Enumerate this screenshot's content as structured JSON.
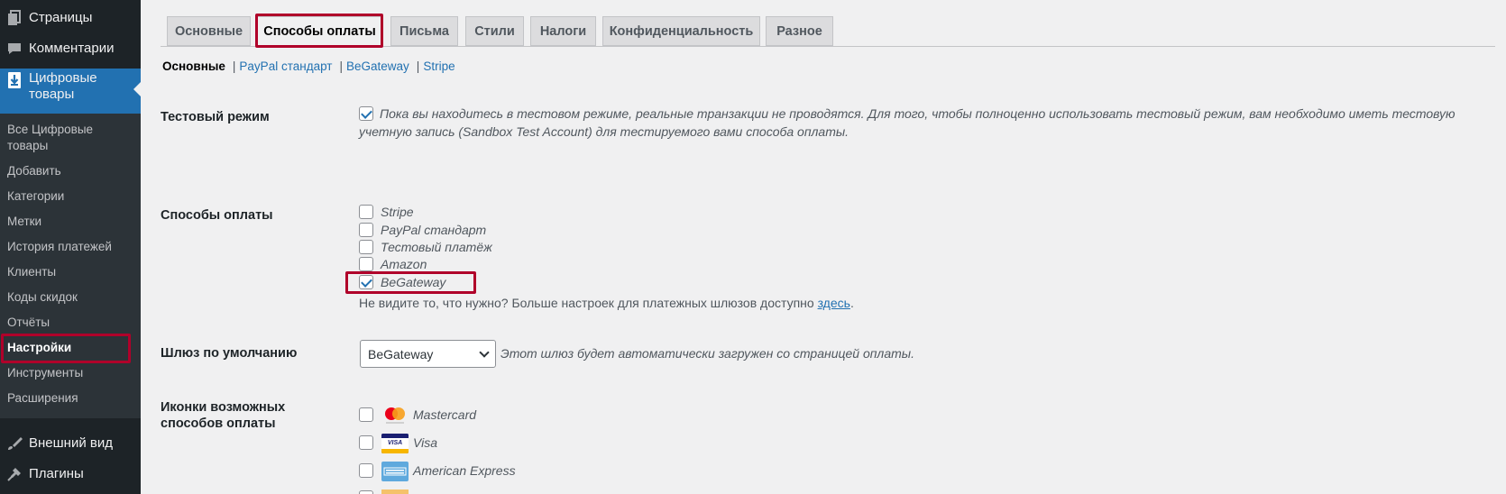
{
  "sidebar": {
    "pages": "Страницы",
    "comments": "Комментарии",
    "downloads": "Цифровые товары",
    "submenu": [
      "Все Цифровые товары",
      "Добавить",
      "Категории",
      "Метки",
      "История платежей",
      "Клиенты",
      "Коды скидок",
      "Отчёты",
      "Настройки",
      "Инструменты",
      "Расширения"
    ],
    "appearance": "Внешний вид",
    "plugins": "Плагины"
  },
  "tabs": [
    "Основные",
    "Способы оплаты",
    "Письма",
    "Стили",
    "Налоги",
    "Конфиденциальность",
    "Разное"
  ],
  "subnav": {
    "current": "Основные",
    "links": [
      "PayPal стандарт",
      "BeGateway",
      "Stripe"
    ]
  },
  "test_mode": {
    "label": "Тестовый режим",
    "checked": true,
    "desc_line1": "Пока вы находитесь в тестовом режиме, реальные транзакции не проводятся. Для того, чтобы полноценно использовать тестовый режим, вам необходимо иметь тестовую",
    "desc_line2": "учетную запись (Sandbox Test Account) для тестируемого вами способа оплаты."
  },
  "gateways": {
    "label": "Способы оплаты",
    "options": [
      "Stripe",
      "PayPal стандарт",
      "Тестовый платёж",
      "Amazon",
      "BeGateway"
    ],
    "checked": [
      false,
      false,
      false,
      false,
      true
    ],
    "note_text": "Не видите то, что нужно? Больше настроек для платежных шлюзов доступно ",
    "note_link": "здесь",
    "note_end": "."
  },
  "default_gateway": {
    "label": "Шлюз по умолчанию",
    "value": "BeGateway",
    "desc": "Этот шлюз будет автоматически загружен со страницей оплаты."
  },
  "icons": {
    "label_line1": "Иконки возможных",
    "label_line2": "способов оплаты",
    "options": [
      "Mastercard",
      "Visa",
      "American Express"
    ],
    "visa_text": "VISA"
  },
  "colors": {
    "sidebar_bg": "#1d2327",
    "submenu_bg": "#2c3338",
    "active_menu": "#2271b1",
    "highlight": "#b0002a",
    "link": "#2271b1"
  }
}
